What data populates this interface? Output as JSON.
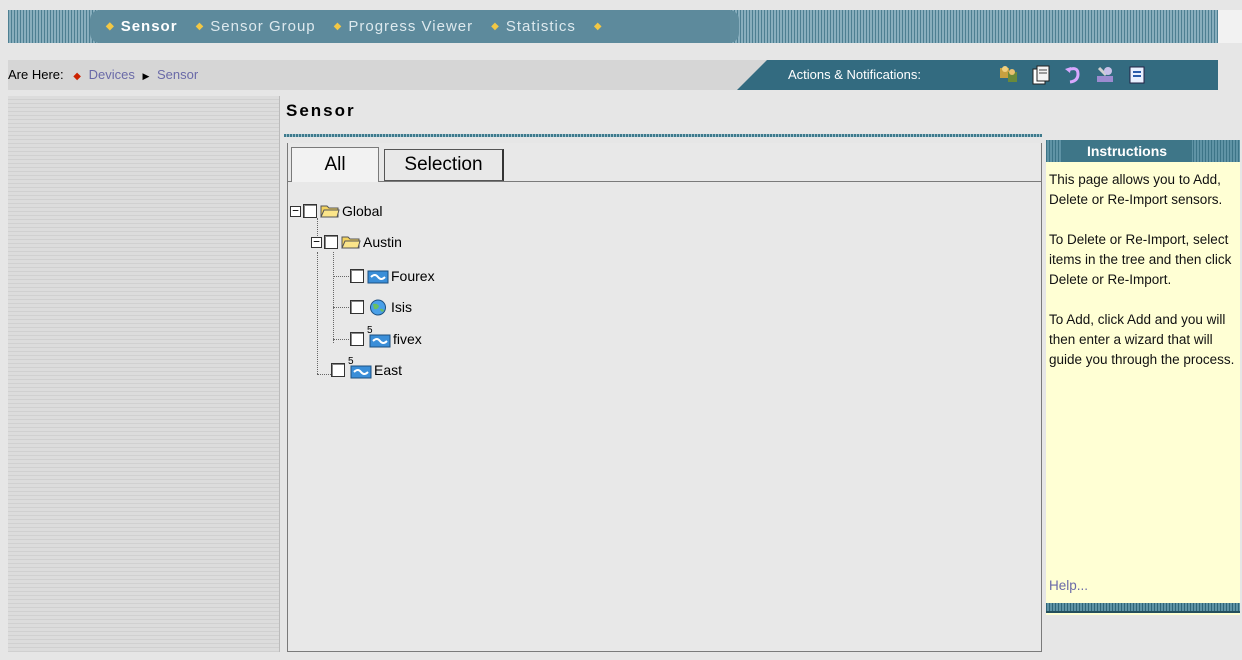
{
  "nav": {
    "tabs": [
      {
        "label": "Sensor"
      },
      {
        "label": "Sensor Group"
      },
      {
        "label": "Progress Viewer"
      },
      {
        "label": "Statistics"
      }
    ]
  },
  "breadcrumb": {
    "prefix": "Are Here:",
    "items": [
      "Devices",
      "Sensor"
    ]
  },
  "actions": {
    "label": "Actions & Notifications:",
    "icons": [
      "users-icon",
      "document-icon",
      "undo-icon",
      "tools-icon",
      "notepad-icon"
    ]
  },
  "page": {
    "title": "Sensor"
  },
  "panel": {
    "tab_all": "All",
    "tab_selection": "Selection"
  },
  "tree": {
    "global": "Global",
    "austin": "Austin",
    "fourex": "Fourex",
    "isis": "Isis",
    "fivex": "fivex",
    "east": "East",
    "fivex_badge": "5",
    "east_badge": "5"
  },
  "instructions": {
    "title": "Instructions",
    "p1": "This page allows you to Add, Delete or Re-Import sensors.",
    "p2": "To Delete or Re-Import, select items in the tree and then click Delete or Re-Import.",
    "p3": "To Add, click Add and you will then enter a wizard that will guide you through the process.",
    "help": "Help..."
  },
  "colors": {
    "tab_bar": "#5d8a9c",
    "accent_dot": "#f3c844",
    "actions_bar": "#336b80",
    "instructions_bg": "#ffffd4",
    "link": "#6a6aa8"
  }
}
